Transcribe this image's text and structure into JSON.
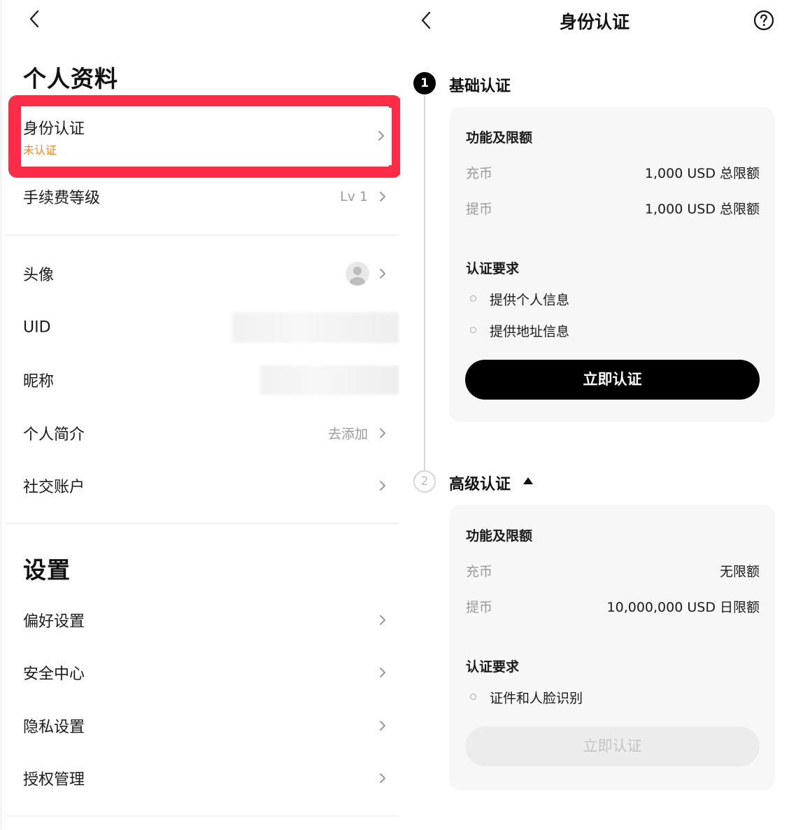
{
  "profile": {
    "section_title": "个人资料",
    "kyc": {
      "label": "身份认证",
      "status": "未认证",
      "status_color": "#f08a2a"
    },
    "fee_level": {
      "label": "手续费等级",
      "value": "Lv 1"
    },
    "avatar": {
      "label": "头像"
    },
    "uid": {
      "label": "UID"
    },
    "nickname": {
      "label": "昵称"
    },
    "bio": {
      "label": "个人简介",
      "value": "去添加"
    },
    "social": {
      "label": "社交账户"
    }
  },
  "settings": {
    "section_title": "设置",
    "items": [
      {
        "label": "偏好设置"
      },
      {
        "label": "安全中心"
      },
      {
        "label": "隐私设置"
      },
      {
        "label": "授权管理"
      }
    ]
  },
  "highlight_color": "#ff2b47",
  "verification": {
    "title": "身份认证",
    "basic": {
      "step": "1",
      "title": "基础认证",
      "features_title": "功能及限额",
      "deposit_label": "充币",
      "deposit_value": "1,000 USD 总限额",
      "withdraw_label": "提币",
      "withdraw_value": "1,000 USD 总限额",
      "requirements_title": "认证要求",
      "requirements": [
        "提供个人信息",
        "提供地址信息"
      ],
      "button": "立即认证"
    },
    "advanced": {
      "step": "2",
      "title": "高级认证",
      "features_title": "功能及限额",
      "deposit_label": "充币",
      "deposit_value": "无限额",
      "withdraw_label": "提币",
      "withdraw_value": "10,000,000 USD 日限额",
      "requirements_title": "认证要求",
      "requirements": [
        "证件和人脸识别"
      ],
      "button": "立即认证"
    }
  }
}
